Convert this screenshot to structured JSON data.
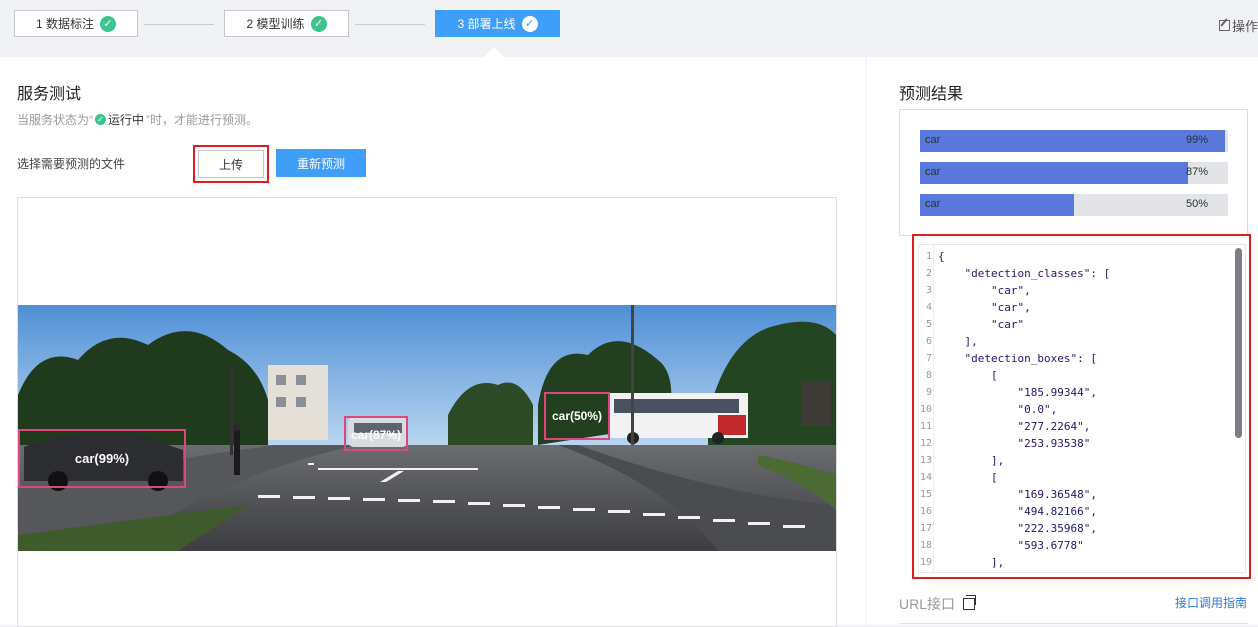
{
  "stepper": {
    "steps": [
      {
        "label": "1 数据标注"
      },
      {
        "label": "2 模型训练"
      },
      {
        "label": "3 部署上线"
      }
    ],
    "operation_label": "操作"
  },
  "left": {
    "title": "服务测试",
    "hint_prefix": "当服务状态为“",
    "hint_status": "运行中",
    "hint_suffix": "”时，才能进行预测。",
    "file_label": "选择需要预测的文件",
    "upload_label": "上传",
    "repredict_label": "重新预测",
    "detections": [
      {
        "label": "car(99%)"
      },
      {
        "label": "car(87%)"
      },
      {
        "label": "car(50%)"
      }
    ]
  },
  "right": {
    "title": "预测结果",
    "results": [
      {
        "label": "car",
        "percent": "99%",
        "value": 0.99
      },
      {
        "label": "car",
        "percent": "87%",
        "value": 0.87
      },
      {
        "label": "car",
        "percent": "50%",
        "value": 0.5
      }
    ],
    "json_lines": [
      {
        "n": "1",
        "t": "{"
      },
      {
        "n": "2",
        "t": "    \"detection_classes\": ["
      },
      {
        "n": "3",
        "t": "        \"car\","
      },
      {
        "n": "4",
        "t": "        \"car\","
      },
      {
        "n": "5",
        "t": "        \"car\""
      },
      {
        "n": "6",
        "t": "    ],"
      },
      {
        "n": "7",
        "t": "    \"detection_boxes\": ["
      },
      {
        "n": "8",
        "t": "        ["
      },
      {
        "n": "9",
        "t": "            \"185.99344\","
      },
      {
        "n": "10",
        "t": "            \"0.0\","
      },
      {
        "n": "11",
        "t": "            \"277.2264\","
      },
      {
        "n": "12",
        "t": "            \"253.93538\""
      },
      {
        "n": "13",
        "t": "        ],"
      },
      {
        "n": "14",
        "t": "        ["
      },
      {
        "n": "15",
        "t": "            \"169.36548\","
      },
      {
        "n": "16",
        "t": "            \"494.82166\","
      },
      {
        "n": "17",
        "t": "            \"222.35968\","
      },
      {
        "n": "18",
        "t": "            \"593.6778\""
      },
      {
        "n": "19",
        "t": "        ],"
      }
    ],
    "url_label": "URL接口",
    "guide_label": "接口调用指南"
  },
  "colors": {
    "accent": "#3e9ef8",
    "success": "#3cc48f",
    "bar": "#5a78da",
    "highlight": "#e01d1d",
    "detection_box": "#e0457b"
  }
}
